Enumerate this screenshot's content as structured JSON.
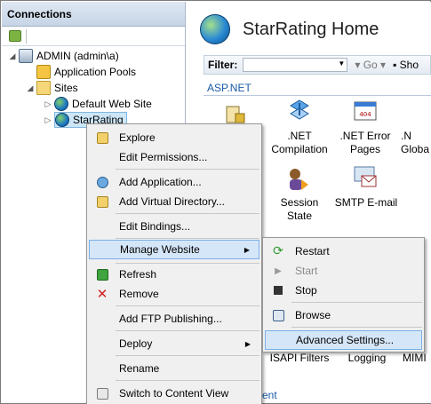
{
  "connections": {
    "header": "Connections",
    "tree": {
      "server": "ADMIN (admin\\a)",
      "app_pools": "Application Pools",
      "sites": "Sites",
      "default_site": "Default Web Site",
      "selected_site": "StarRating"
    }
  },
  "home": {
    "title": "StarRating Home",
    "filter_label": "Filter:",
    "go_label": "Go",
    "show_label": "Sho",
    "group": "ASP.NET",
    "features": {
      "net_compilation": ".NET Compilation",
      "net_error_pages": ".NET Error Pages",
      "globalization_partial": ".N Globa",
      "session_state": "Session State",
      "smtp_email": "SMTP E-mail",
      "isapi_filters": "ISAPI Filters",
      "logging": "Logging",
      "mime_partial": "MIMI",
      "bottom_partial": "ent"
    }
  },
  "context_menu": {
    "explore": "Explore",
    "edit_permissions": "Edit Permissions...",
    "add_application": "Add Application...",
    "add_virtual_directory": "Add Virtual Directory...",
    "edit_bindings": "Edit Bindings...",
    "manage_website": "Manage Website",
    "refresh": "Refresh",
    "remove": "Remove",
    "add_ftp_publishing": "Add FTP Publishing...",
    "deploy": "Deploy",
    "rename": "Rename",
    "switch_to_content_view": "Switch to Content View"
  },
  "submenu": {
    "restart": "Restart",
    "start": "Start",
    "stop": "Stop",
    "browse": "Browse",
    "advanced_settings": "Advanced Settings..."
  },
  "icons": {
    "server": "server-icon",
    "app_pools": "app-pools-icon",
    "sites": "folder-icon",
    "site": "globe-icon",
    "refresh": "refresh-icon",
    "remove": "remove-x-icon"
  },
  "colors": {
    "menu_highlight": "#d5e6f8",
    "remove_red": "#d32020",
    "group_blue": "#1a5aa8"
  }
}
